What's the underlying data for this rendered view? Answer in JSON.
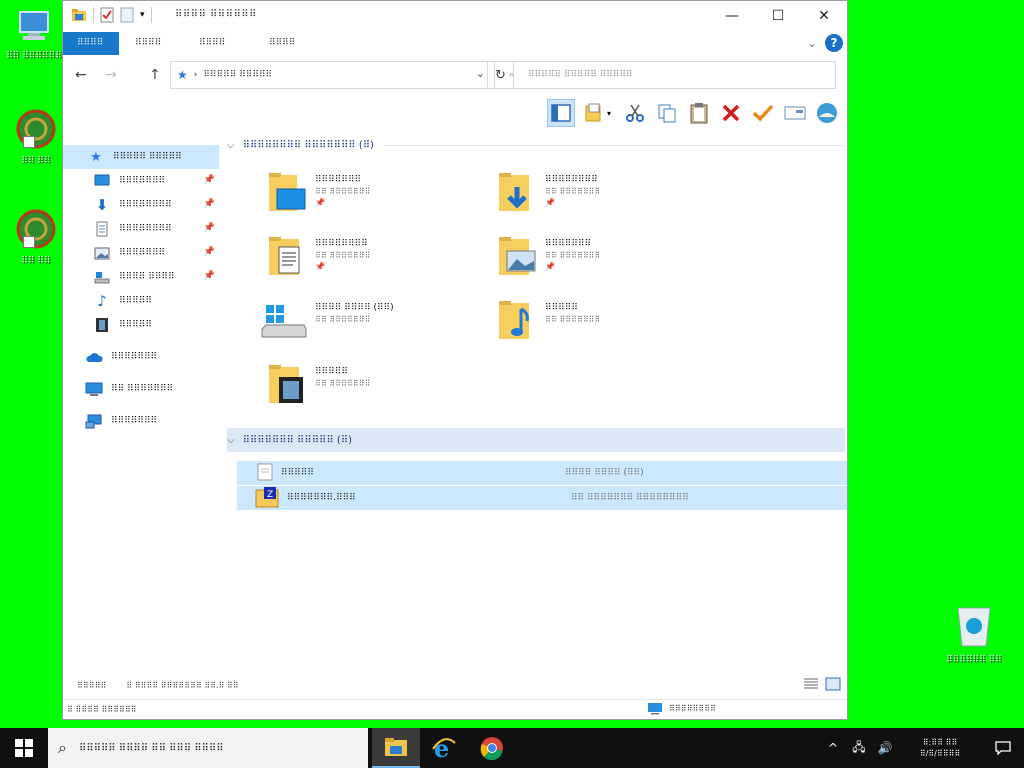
{
  "desktop": {
    "icons": [
      {
        "label": "⠿⠿ ⠿⠿⠿⠿⠿⠿"
      },
      {
        "label": "⠿⠿ ⠿⠿"
      },
      {
        "label": "⠿⠿ ⠿⠿"
      }
    ],
    "recycle_bin": {
      "label": "⠿⠿⠿⠿⠿⠿ ⠿⠿"
    }
  },
  "window": {
    "title": "⠿⠿⠿⠿ ⠿⠿⠿⠿⠿⠿",
    "controls": {
      "minimize": "—",
      "maximize": "☐",
      "close": "✕"
    },
    "ribbon_tabs": [
      "⠿⠿⠿⠿",
      "⠿⠿⠿⠿",
      "⠿⠿⠿⠿",
      "⠿⠿⠿⠿"
    ],
    "ribbon_expand": "⌄",
    "help": "?",
    "nav": {
      "back": "←",
      "forward": "→",
      "up": "↑"
    },
    "address": {
      "separator": "›",
      "path": "⠿⠿⠿⠿⠿ ⠿⠿⠿⠿⠿",
      "dropdown": "⌄",
      "refresh": "↻"
    },
    "search": {
      "placeholder": "⠿⠿⠿⠿⠿ ⠿⠿⠿⠿⠿ ⠿⠿⠿⠿⠿"
    },
    "toolbar": [
      "preview-pane",
      "layout",
      "cut",
      "copy",
      "paste",
      "delete",
      "rename",
      "properties",
      "shell"
    ],
    "nav_pane": {
      "quick_access": "⠿⠿⠿⠿⠿ ⠿⠿⠿⠿⠿",
      "items": [
        {
          "label": "⠿⠿⠿⠿⠿⠿⠿",
          "pinned": true
        },
        {
          "label": "⠿⠿⠿⠿⠿⠿⠿⠿",
          "pinned": true
        },
        {
          "label": "⠿⠿⠿⠿⠿⠿⠿⠿",
          "pinned": true
        },
        {
          "label": "⠿⠿⠿⠿⠿⠿⠿",
          "pinned": true
        },
        {
          "label": "⠿⠿⠿⠿ ⠿⠿⠿⠿",
          "pinned": true
        },
        {
          "label": "⠿⠿⠿⠿⠿",
          "pinned": false
        },
        {
          "label": "⠿⠿⠿⠿⠿",
          "pinned": false
        }
      ],
      "onedrive": "⠿⠿⠿⠿⠿⠿⠿",
      "this_pc": "⠿⠿ ⠿⠿⠿⠿⠿⠿⠿",
      "network": "⠿⠿⠿⠿⠿⠿⠿"
    },
    "frequent": {
      "header": "⠿⠿⠿⠿⠿⠿⠿⠿ ⠿⠿⠿⠿⠿⠿⠿ (⠿)",
      "folders": [
        {
          "name": "⠿⠿⠿⠿⠿⠿⠿",
          "sub": "⠿⠿ ⠿⠿⠿⠿⠿⠿⠿",
          "pin": "📌"
        },
        {
          "name": "⠿⠿⠿⠿⠿⠿⠿⠿",
          "sub": "⠿⠿ ⠿⠿⠿⠿⠿⠿⠿",
          "pin": "📌"
        },
        {
          "name": "⠿⠿⠿⠿⠿⠿⠿⠿",
          "sub": "⠿⠿ ⠿⠿⠿⠿⠿⠿⠿",
          "pin": "📌"
        },
        {
          "name": "⠿⠿⠿⠿⠿⠿⠿",
          "sub": "⠿⠿ ⠿⠿⠿⠿⠿⠿⠿",
          "pin": "📌"
        },
        {
          "name": "⠿⠿⠿⠿ ⠿⠿⠿⠿ (⠿⠿)",
          "sub": "⠿⠿ ⠿⠿⠿⠿⠿⠿⠿",
          "pin": ""
        },
        {
          "name": "⠿⠿⠿⠿⠿",
          "sub": "⠿⠿ ⠿⠿⠿⠿⠿⠿⠿",
          "pin": ""
        },
        {
          "name": "⠿⠿⠿⠿⠿",
          "sub": "⠿⠿ ⠿⠿⠿⠿⠿⠿⠿",
          "pin": ""
        }
      ]
    },
    "recent": {
      "header": "⠿⠿⠿⠿⠿⠿⠿ ⠿⠿⠿⠿⠿ (⠿)",
      "files": [
        {
          "name": "⠿⠿⠿⠿⠿",
          "location": "⠿⠿⠿⠿ ⠿⠿⠿⠿ (⠿⠿)"
        },
        {
          "name": "⠿⠿⠿⠿⠿⠿⠿.⠿⠿⠿",
          "location": "⠿⠿ ⠿⠿⠿⠿⠿⠿⠿ ⠿⠿⠿⠿⠿⠿⠿⠿"
        }
      ]
    },
    "status": {
      "count": "⠿⠿⠿⠿⠿",
      "selected": "⠿ ⠿⠿⠿⠿ ⠿⠿⠿⠿⠿⠿⠿ ⠿⠿.⠿ ⠿⠿"
    },
    "bottom": {
      "left": "⠿ ⠿⠿⠿⠿ ⠿⠿⠿⠿⠿⠿",
      "right": "⠿⠿⠿⠿⠿⠿⠿⠿"
    }
  },
  "taskbar": {
    "search_placeholder": "⠿⠿⠿⠿⠿ ⠿⠿⠿⠿ ⠿⠿ ⠿⠿⠿ ⠿⠿⠿⠿",
    "apps": [
      "file-explorer",
      "internet-explorer",
      "chrome"
    ],
    "tray": {
      "chevron": "^",
      "network": "🖧",
      "volume": "🔊"
    },
    "clock": {
      "time": "⠿:⠿⠿ ⠿⠿",
      "date": "⠿/⠿/⠿⠿⠿⠿"
    }
  },
  "colors": {
    "desktop": "#00ff00",
    "accent": "#1979ca",
    "selection": "#cce8ff",
    "taskbar": "#101010"
  }
}
